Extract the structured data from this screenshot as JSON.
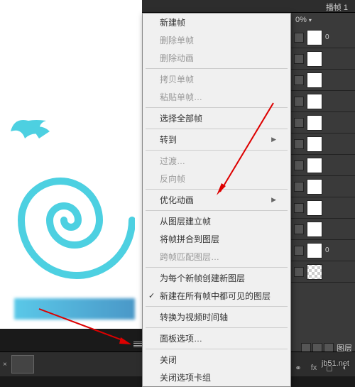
{
  "tab_header": "播帧 1",
  "opacity_value": "0%",
  "menu": {
    "new_frame": "新建帧",
    "delete_frame": "删除单帧",
    "delete_animation": "删除动画",
    "copy_frame": "拷贝单帧",
    "paste_frame": "粘贴单帧…",
    "select_all": "选择全部帧",
    "goto": "转到",
    "tween": "过渡…",
    "reverse": "反向帧",
    "optimize": "优化动画",
    "make_frames_from_layers": "从图层建立帧",
    "flatten_to_layers": "将帧拼合到图层",
    "match_layers": "跨帧匹配图层…",
    "new_layer_per_frame": "为每个新帧创建新图层",
    "new_layers_visible": "新建在所有帧中都可见的图层",
    "convert_to_video": "转换为视频时间轴",
    "panel_options": "面板选项…",
    "close": "关闭",
    "close_tab_group": "关闭选项卡组"
  },
  "layers_tab_label": "图层",
  "layer_label_0": "0",
  "fx_label": "fx",
  "watermark": "jb51.net"
}
